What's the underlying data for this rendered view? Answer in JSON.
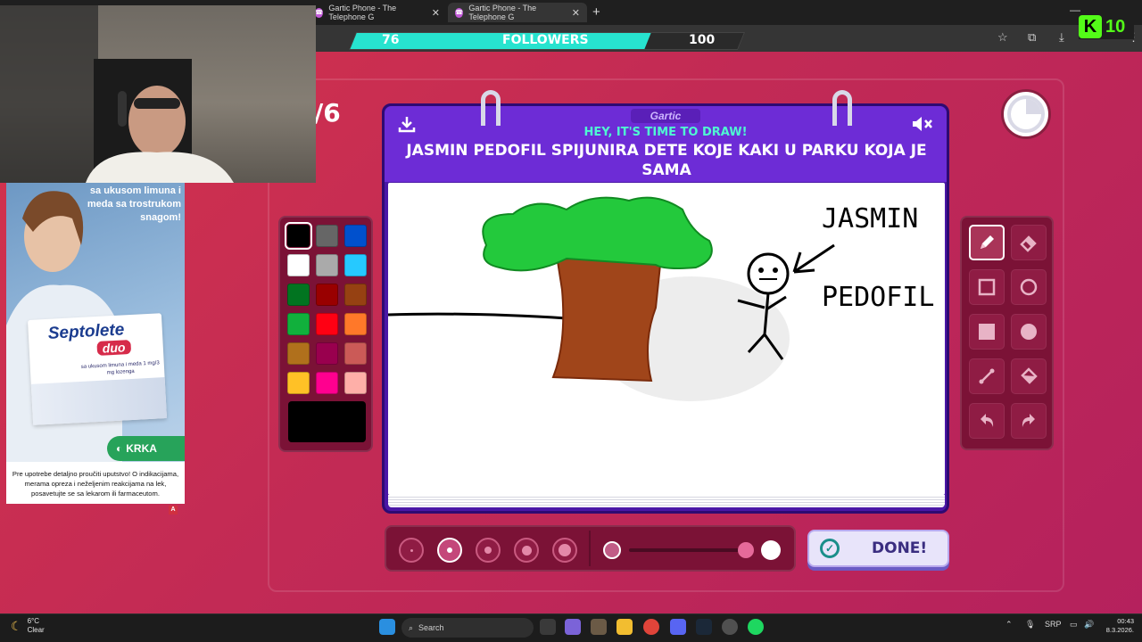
{
  "browser": {
    "tabs": [
      {
        "label": "Gartic Phone - The Telephone G"
      },
      {
        "label": "Gartic Phone - The Telephone G"
      }
    ],
    "new_tab": "+",
    "window_controls": [
      "—",
      "□",
      "✕"
    ]
  },
  "stream_overlay": {
    "followers_current": "76",
    "followers_label": "FOLLOWERS",
    "followers_goal": "100",
    "followers_progress": 0.76,
    "kick_badge": {
      "letter": "K",
      "value": "10"
    }
  },
  "game": {
    "round_counter_partial": "/6",
    "timer_remaining_fraction": 0.75,
    "card": {
      "brand": "Gartic",
      "prompt_header": "HEY, IT'S TIME TO DRAW!",
      "prompt_text": "JASMIN PEDOFIL SPIJUNIRA DETE KOJE KAKI U PARKU KOJA JE SAMA"
    },
    "palette": {
      "colors": [
        "#000000",
        "#666666",
        "#0050cd",
        "#ffffff",
        "#aaaaaa",
        "#26c9ff",
        "#017420",
        "#990000",
        "#964112",
        "#11b03c",
        "#ff0013",
        "#ff7829",
        "#b0701c",
        "#99004e",
        "#cb5a57",
        "#ffc126",
        "#ff008f",
        "#feafa8"
      ],
      "selected": "#000000"
    },
    "tools": [
      "pencil-icon",
      "eraser-icon",
      "rectangle-outline-icon",
      "circle-outline-icon",
      "rectangle-filled-icon",
      "circle-filled-icon",
      "line-icon",
      "fill-bucket-icon",
      "undo-icon",
      "redo-icon"
    ],
    "brush_sizes_selected_index": 1,
    "opacity": 1.0,
    "done_label": "DONE!"
  },
  "drawing": {
    "labels": [
      "JASMIN",
      "PEDOFIL"
    ]
  },
  "ad": {
    "headline": "sa ukusom limuna i meda sa trostrukom snagom!",
    "brand": "Septolete",
    "variant": "duo",
    "pack_line": "sa ukusom limuna i meda 1 mg/3 mg lozenga",
    "company": "KRKA",
    "disclaimer": "Pre upotrebe detaljno proučiti uputstvo! O indikacijama, merama opreza i neželjenim reakcijama na lek, posavetujte se sa lekarom ili farmaceutom.",
    "mark": "A"
  },
  "taskbar": {
    "weather_temp": "6°C",
    "weather_desc": "Clear",
    "search_placeholder": "Search",
    "language": "SRP",
    "time": "00:43",
    "date": "8.3.2026."
  }
}
